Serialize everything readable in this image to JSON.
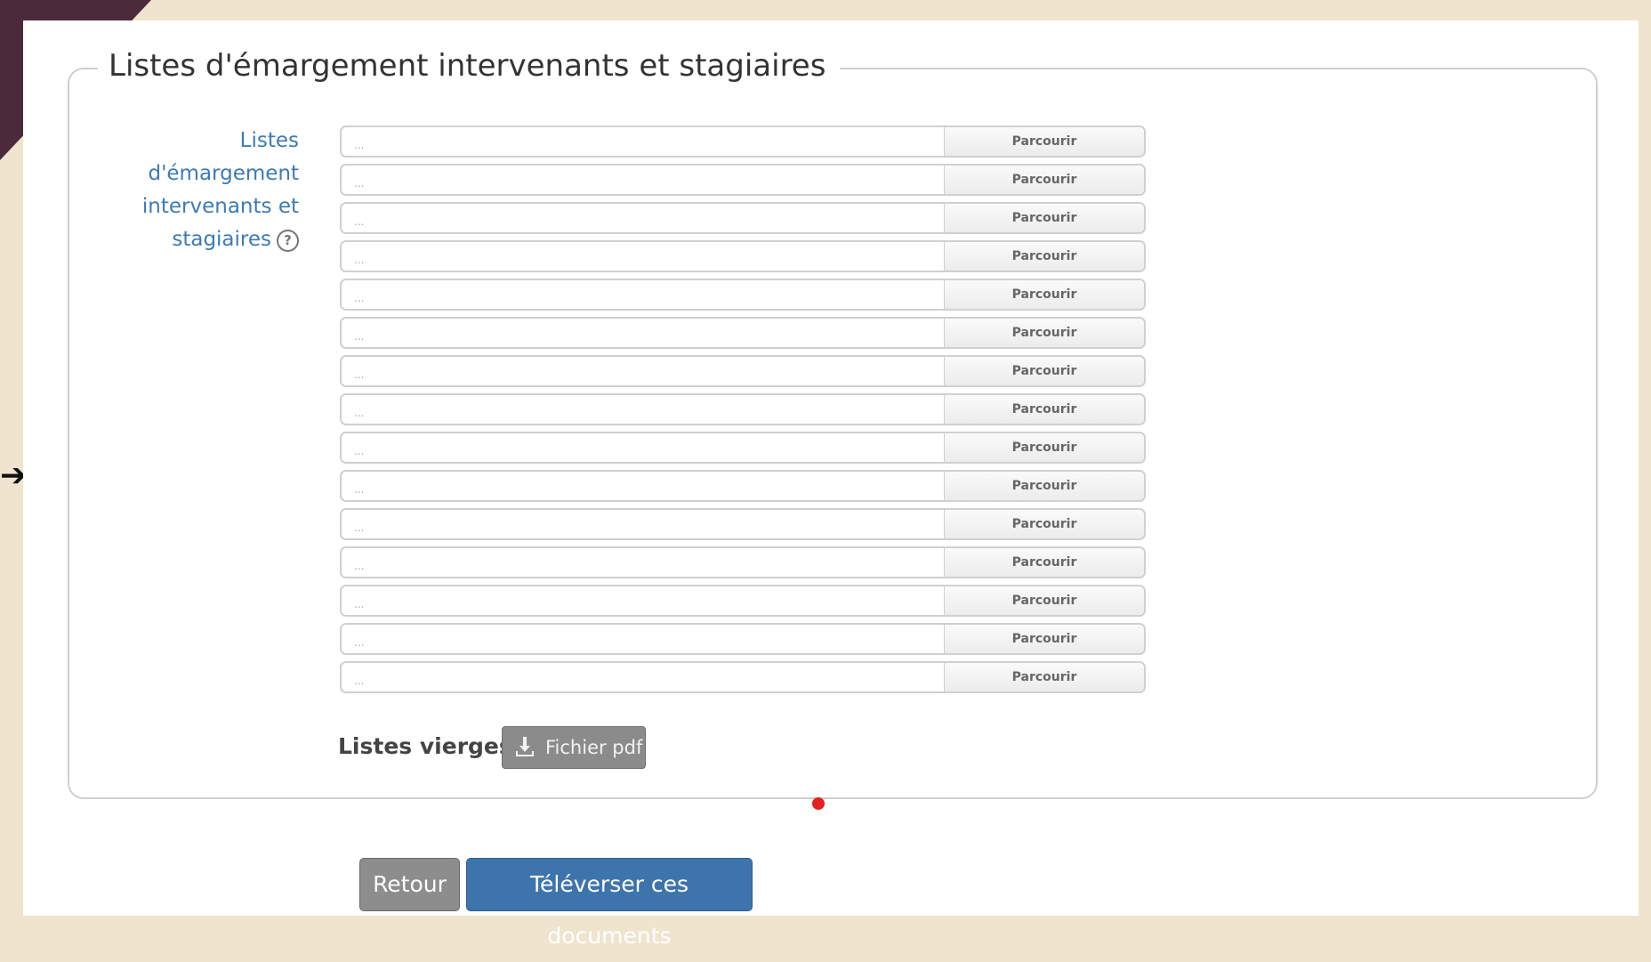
{
  "fieldset": {
    "legend": "Listes d'émargement intervenants et stagiaires",
    "field_label_lines": [
      "Listes d'émargement",
      "intervenants et",
      "stagiaires"
    ],
    "help_icon": "question-circle-icon"
  },
  "file_inputs": [
    {
      "value": "...",
      "button": "Parcourir"
    },
    {
      "value": "...",
      "button": "Parcourir"
    },
    {
      "value": "...",
      "button": "Parcourir"
    },
    {
      "value": "...",
      "button": "Parcourir"
    },
    {
      "value": "...",
      "button": "Parcourir"
    },
    {
      "value": "...",
      "button": "Parcourir"
    },
    {
      "value": "...",
      "button": "Parcourir"
    },
    {
      "value": "...",
      "button": "Parcourir"
    },
    {
      "value": "...",
      "button": "Parcourir"
    },
    {
      "value": "...",
      "button": "Parcourir"
    },
    {
      "value": "...",
      "button": "Parcourir"
    },
    {
      "value": "...",
      "button": "Parcourir"
    },
    {
      "value": "...",
      "button": "Parcourir"
    },
    {
      "value": "...",
      "button": "Parcourir"
    },
    {
      "value": "...",
      "button": "Parcourir"
    }
  ],
  "blank_lists": {
    "label": "Listes vierges :",
    "button": "Fichier pdf",
    "icon": "download-icon"
  },
  "actions": {
    "back": "Retour",
    "upload": "Téléverser ces documents"
  },
  "colors": {
    "background": "#f0e4cf",
    "accent_blue": "#3e74ac",
    "label_blue": "#3d7bb3",
    "gray_button": "#8b8b8b",
    "marker_red": "#e3211f",
    "corner_purple": "#4a2a3b"
  }
}
